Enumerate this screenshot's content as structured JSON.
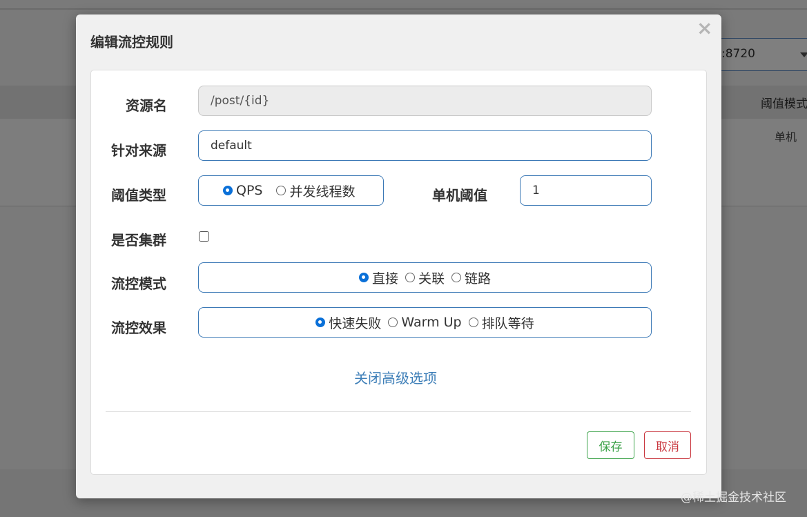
{
  "background": {
    "app_select_value": ":8720",
    "table_header_partial": "阈值模式",
    "table_cell_partial": "单机"
  },
  "modal": {
    "title": "编辑流控规则",
    "close_icon": "×",
    "fields": {
      "resource_name": {
        "label": "资源名",
        "value": "/post/{id}"
      },
      "limit_app": {
        "label": "针对来源",
        "value": "default"
      },
      "grade": {
        "label": "阈值类型",
        "options": [
          "QPS",
          "并发线程数"
        ],
        "selected": "QPS"
      },
      "count": {
        "label": "单机阈值",
        "value": "1"
      },
      "cluster_mode": {
        "label": "是否集群",
        "checked": false
      },
      "strategy": {
        "label": "流控模式",
        "options": [
          "直接",
          "关联",
          "链路"
        ],
        "selected": "直接"
      },
      "control_behavior": {
        "label": "流控效果",
        "options": [
          "快速失败",
          "Warm Up",
          "排队等待"
        ],
        "selected": "快速失败"
      }
    },
    "advanced_toggle": "关闭高级选项",
    "buttons": {
      "save": "保存",
      "cancel": "取消"
    }
  },
  "watermark": "@稀土掘金技术社区",
  "colors": {
    "accent_border": "#3c79b6",
    "radio_checked": "#0a70d8",
    "save": "#3da34a",
    "cancel": "#c9363e",
    "link": "#3e7fb8"
  }
}
